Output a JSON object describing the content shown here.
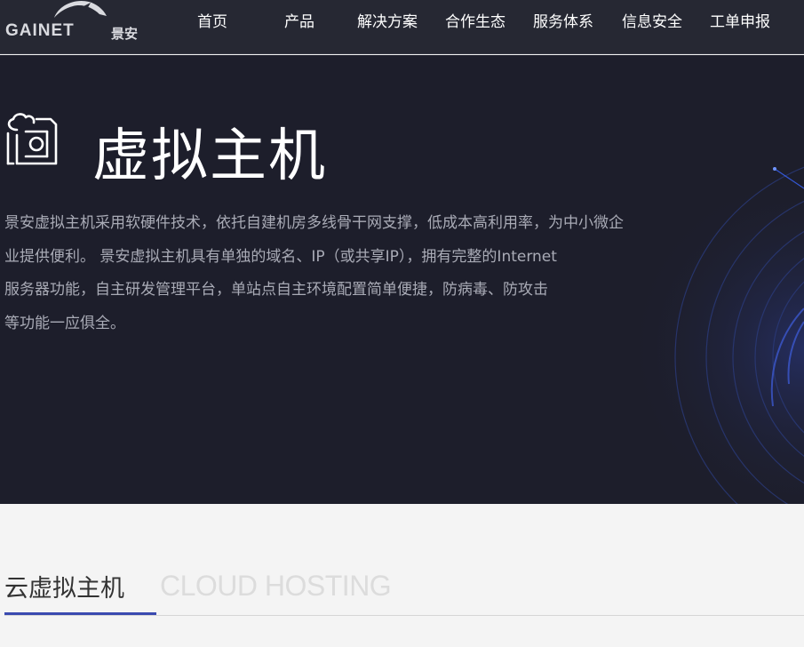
{
  "header": {
    "logo": {
      "text": "GAINET",
      "cn": "景安"
    },
    "nav": [
      {
        "label": "首页"
      },
      {
        "label": "产品"
      },
      {
        "label": "解决方案"
      },
      {
        "label": "合作生态"
      },
      {
        "label": "服务体系"
      },
      {
        "label": "信息安全"
      },
      {
        "label": "工单申报"
      }
    ]
  },
  "hero": {
    "title": "虚拟主机",
    "description": [
      "景安虚拟主机采用软硬件技术，依托自建机房多线骨干网支撑，低成本高利用率，为中小微企",
      "业提供便利。 景安虚拟主机具有单独的域名、IP（或共享IP），拥有完整的Internet",
      "服务器功能，自主研发管理平台，单站点自主环境配置简单便捷，防病毒、防攻击",
      "等功能一应俱全。"
    ],
    "icon": "cloud-server-icon"
  },
  "section": {
    "tab_cn": "云虚拟主机",
    "tab_en": "CLOUD HOSTING"
  },
  "colors": {
    "header_bg": "#262833",
    "hero_bg": "#1d1e2b",
    "accent": "#3a4ab0",
    "page_bg": "#f4f4f4"
  }
}
